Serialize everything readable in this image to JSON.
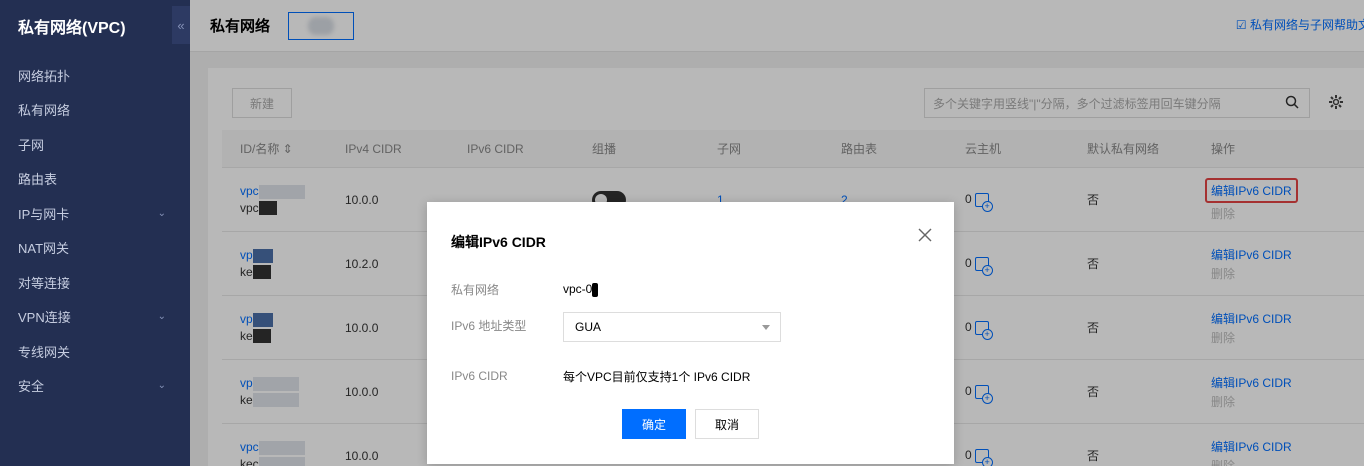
{
  "sidebar": {
    "title": "私有网络(VPC)",
    "collapse_glyph": "«",
    "items": [
      {
        "label": "网络拓扑",
        "expandable": false
      },
      {
        "label": "私有网络",
        "expandable": false
      },
      {
        "label": "子网",
        "expandable": false
      },
      {
        "label": "路由表",
        "expandable": false
      },
      {
        "label": "IP与网卡",
        "expandable": true
      },
      {
        "label": "NAT网关",
        "expandable": false
      },
      {
        "label": "对等连接",
        "expandable": false
      },
      {
        "label": "VPN连接",
        "expandable": true
      },
      {
        "label": "专线网关",
        "expandable": false
      },
      {
        "label": "安全",
        "expandable": true
      }
    ]
  },
  "header": {
    "title": "私有网络",
    "help_link": "私有网络与子网帮助文"
  },
  "toolbar": {
    "new_button": "新建",
    "search_placeholder": "多个关键字用竖线\"|\"分隔，多个过滤标签用回车键分隔"
  },
  "table": {
    "columns": [
      "ID/名称 ⇕",
      "IPv4 CIDR",
      "IPv6 CIDR",
      "组播",
      "子网",
      "路由表",
      "云主机",
      "默认私有网络",
      "操作"
    ],
    "rows": [
      {
        "id": "vpc",
        "name": "vpc",
        "ipv4": "10.0.0",
        "subnet": "1",
        "route": "2",
        "hosts": "0",
        "default": "否",
        "op_edit": "编辑IPv6 CIDR",
        "op_delete": "删除"
      },
      {
        "id": "vp",
        "name": "ke",
        "ipv4": "10.2.0",
        "subnet": "",
        "route": "",
        "hosts": "0",
        "default": "否",
        "op_edit": "编辑IPv6 CIDR",
        "op_delete": "删除"
      },
      {
        "id": "vp",
        "name": "ke",
        "ipv4": "10.0.0",
        "subnet": "",
        "route": "",
        "hosts": "0",
        "default": "否",
        "op_edit": "编辑IPv6 CIDR",
        "op_delete": "删除"
      },
      {
        "id": "vp",
        "name": "ke",
        "ipv4": "10.0.0",
        "subnet": "",
        "route": "",
        "hosts": "0",
        "default": "否",
        "op_edit": "编辑IPv6 CIDR",
        "op_delete": "删除"
      },
      {
        "id": "vpc",
        "name": "kec",
        "ipv4": "10.0.0",
        "subnet": "",
        "route": "",
        "hosts": "0",
        "default": "否",
        "op_edit": "编辑IPv6 CIDR",
        "op_delete": "删除"
      }
    ]
  },
  "modal": {
    "title": "编辑IPv6 CIDR",
    "vpc_label": "私有网络",
    "vpc_value": "vpc-0",
    "type_label": "IPv6 地址类型",
    "type_value": "GUA",
    "cidr_label": "IPv6 CIDR",
    "cidr_value": "每个VPC目前仅支持1个 IPv6 CIDR",
    "confirm": "确定",
    "cancel": "取消"
  },
  "colors": {
    "sidebar_bg": "#232f52",
    "accent": "#006eff",
    "highlight": "#e54545"
  }
}
